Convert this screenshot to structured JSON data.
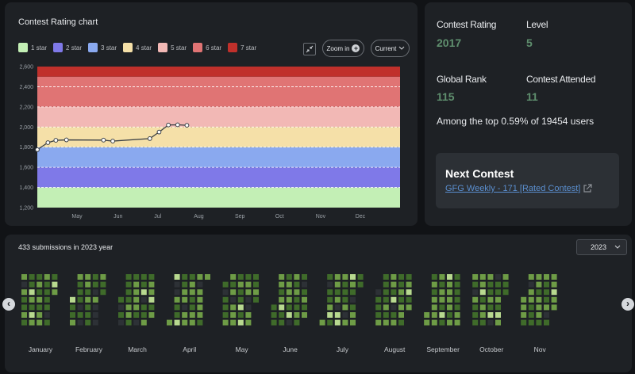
{
  "chart_card": {
    "title": "Contest Rating chart",
    "legend": [
      {
        "label": "1 star",
        "color": "#c3efb5"
      },
      {
        "label": "2 star",
        "color": "#7f79e8"
      },
      {
        "label": "3 star",
        "color": "#8aa9ef"
      },
      {
        "label": "4 star",
        "color": "#f5e0a8"
      },
      {
        "label": "5 star",
        "color": "#f2b8b5"
      },
      {
        "label": "6 star",
        "color": "#e07474"
      },
      {
        "label": "7 star",
        "color": "#c0302b"
      }
    ],
    "zoom_label": "Zoom in",
    "range_select": "Current"
  },
  "chart_data": {
    "type": "line",
    "title": "Contest Rating chart",
    "xlabel": "",
    "ylabel": "",
    "ylim": [
      1200,
      2600
    ],
    "yticks": [
      "1,200",
      "1,400",
      "1,600",
      "1,800",
      "2,000",
      "2,200",
      "2,400",
      "2,600"
    ],
    "xticks": [
      "May",
      "Jun",
      "Jul",
      "Aug",
      "Sep",
      "Oct",
      "Nov",
      "Dec"
    ],
    "bands": [
      {
        "from": 1200,
        "to": 1400,
        "color": "#c3efb5"
      },
      {
        "from": 1400,
        "to": 1600,
        "color": "#7f79e8"
      },
      {
        "from": 1600,
        "to": 1800,
        "color": "#8aa9ef"
      },
      {
        "from": 1800,
        "to": 2000,
        "color": "#f5e0a8"
      },
      {
        "from": 2000,
        "to": 2200,
        "color": "#f2b8b5"
      },
      {
        "from": 2200,
        "to": 2500,
        "color": "#e07474"
      },
      {
        "from": 2500,
        "to": 2600,
        "color": "#c0302b"
      }
    ],
    "series": [
      {
        "points": [
          {
            "x": "2023-04-01",
            "y": 1775
          },
          {
            "x": "2023-04-09",
            "y": 1845
          },
          {
            "x": "2023-04-15",
            "y": 1868
          },
          {
            "x": "2023-04-23",
            "y": 1872
          },
          {
            "x": "2023-05-21",
            "y": 1870
          },
          {
            "x": "2023-05-28",
            "y": 1860
          },
          {
            "x": "2023-06-25",
            "y": 1885
          },
          {
            "x": "2023-07-02",
            "y": 1950
          },
          {
            "x": "2023-07-09",
            "y": 2020
          },
          {
            "x": "2023-07-16",
            "y": 2022
          },
          {
            "x": "2023-07-23",
            "y": 2017
          }
        ]
      }
    ],
    "grid": true
  },
  "stats": {
    "rating_label": "Contest Rating",
    "rating_value": "2017",
    "level_label": "Level",
    "level_value": "5",
    "rank_label": "Global Rank",
    "rank_value": "115",
    "attended_label": "Contest Attended",
    "attended_value": "11",
    "top_text": "Among the top 0.59% of 19454 users"
  },
  "next_contest": {
    "title": "Next Contest",
    "link": "GFG Weekly - 171 [Rated Contest]"
  },
  "heatmap": {
    "title": "433 submissions in 2023 year",
    "year": "2023",
    "months": [
      "January",
      "February",
      "March",
      "April",
      "May",
      "June",
      "July",
      "August",
      "September",
      "October",
      "Nov"
    ],
    "colors": {
      "empty": "#2d3136",
      "low": "#3f6b2a",
      "mid": "#6e9c46",
      "high": "#b8d98f"
    }
  }
}
